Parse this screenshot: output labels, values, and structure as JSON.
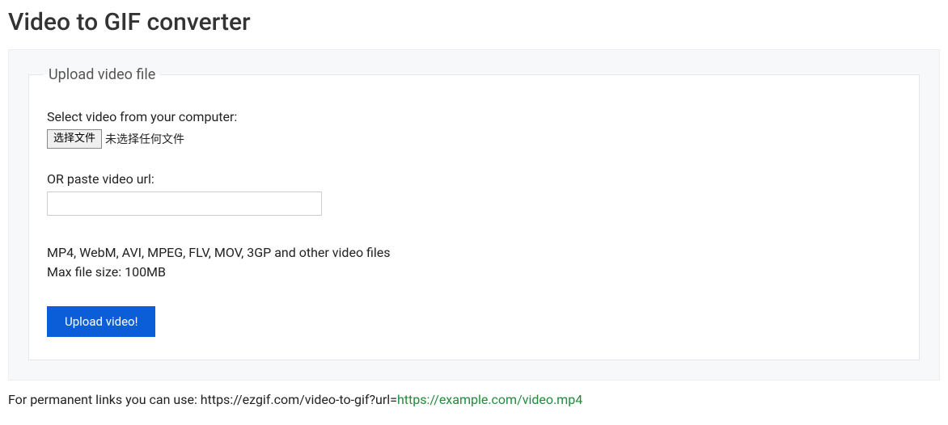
{
  "page": {
    "title": "Video to GIF converter"
  },
  "form": {
    "legend": "Upload video file",
    "select_label": "Select video from your computer:",
    "file_button_label": "选择文件",
    "file_status_text": "未选择任何文件",
    "url_label": "OR paste video url:",
    "url_value": "",
    "hint_line1": "MP4, WebM, AVI, MPEG, FLV, MOV, 3GP and other video files",
    "hint_line2": "Max file size: 100MB",
    "submit_label": "Upload video!"
  },
  "permalink": {
    "prefix": "For permanent links you can use: https://ezgif.com/video-to-gif?url=",
    "example": "https://example.com/video.mp4"
  }
}
